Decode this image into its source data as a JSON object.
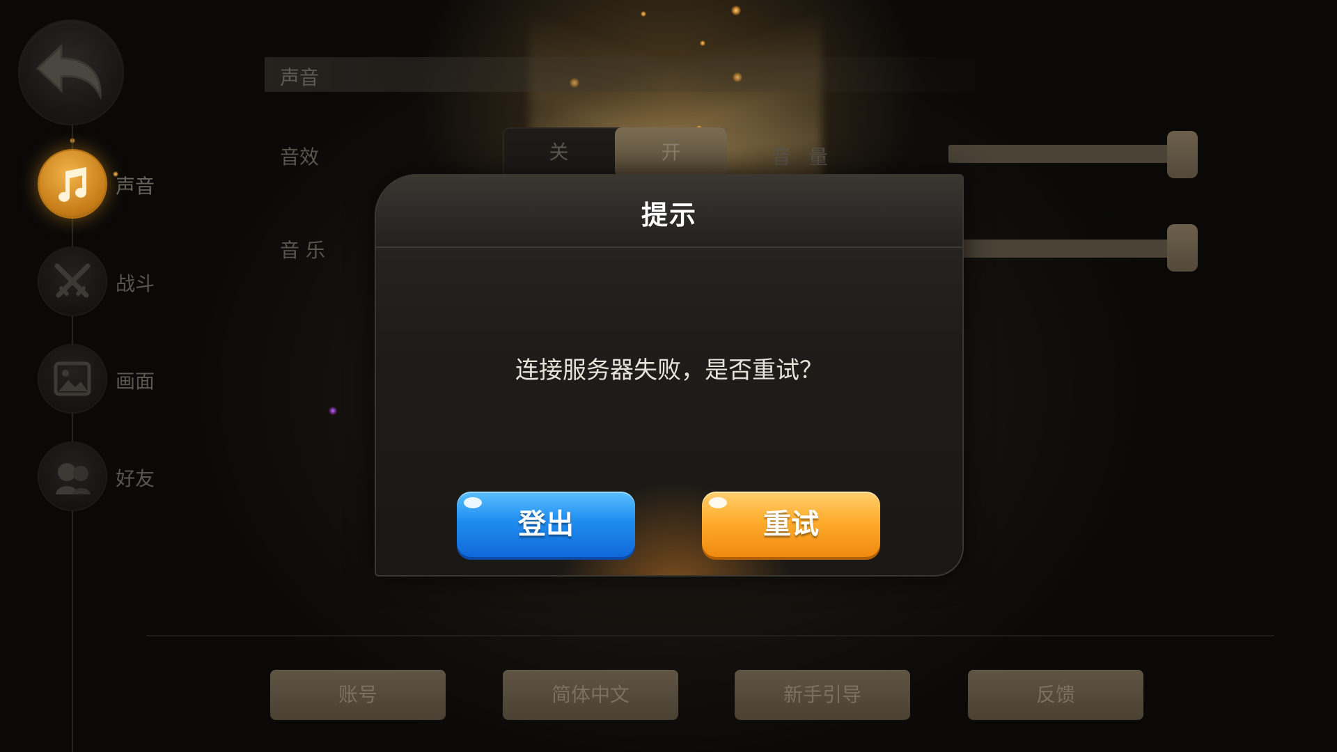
{
  "sidebar": {
    "back_icon": "back-arrow-icon",
    "items": [
      {
        "label": "声音",
        "icon": "music-note-icon",
        "active": true
      },
      {
        "label": "战斗",
        "icon": "crossed-swords-icon",
        "active": false
      },
      {
        "label": "画面",
        "icon": "picture-icon",
        "active": false
      },
      {
        "label": "好友",
        "icon": "friends-icon",
        "active": false
      }
    ]
  },
  "settings": {
    "section_title": "声音",
    "sfx": {
      "label": "音效",
      "toggle_off": "关",
      "toggle_on": "开",
      "selected": "开",
      "volume_label": "音 量",
      "volume_level": 1.0
    },
    "music": {
      "label": "音 乐",
      "volume_level": 1.0
    }
  },
  "bottom_buttons": [
    "账号",
    "简体中文",
    "新手引导",
    "反馈"
  ],
  "dialog": {
    "title": "提示",
    "message": "连接服务器失败，是否重试？",
    "logout_label": "登出",
    "retry_label": "重试"
  },
  "colors": {
    "accent_gold": "#f0a020",
    "logout_blue": "#1f8df0",
    "retry_orange": "#ffac2c"
  }
}
